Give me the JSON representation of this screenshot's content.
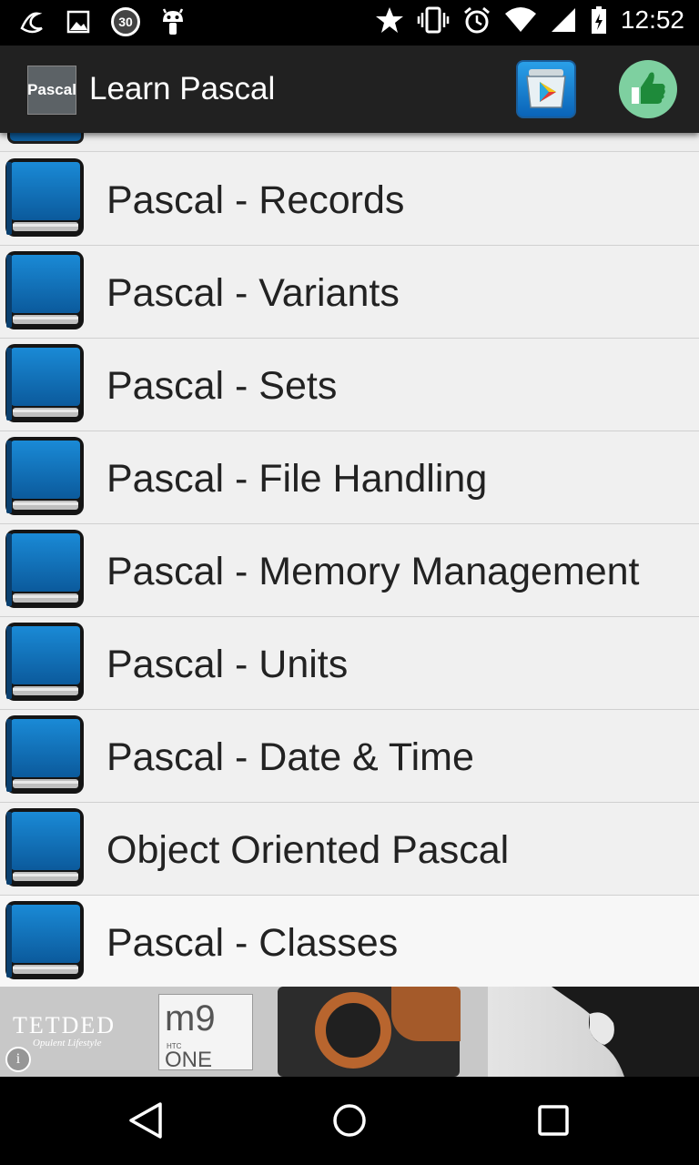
{
  "status_bar": {
    "time": "12:52",
    "notification_badge": "30",
    "left_icons": [
      "weather-icon",
      "image-icon",
      "counter-badge-icon",
      "android-icon"
    ],
    "right_icons": [
      "star-icon",
      "vibrate-icon",
      "alarm-icon",
      "wifi-icon",
      "signal-icon",
      "battery-icon"
    ]
  },
  "toolbar": {
    "logo_text": "Pascal",
    "title": "Learn Pascal",
    "actions": [
      "play-store-icon",
      "thumbs-up-icon"
    ]
  },
  "list": {
    "items": [
      {
        "label": "Pascal - Records"
      },
      {
        "label": "Pascal - Variants"
      },
      {
        "label": "Pascal - Sets"
      },
      {
        "label": "Pascal - File Handling"
      },
      {
        "label": "Pascal - Memory Management"
      },
      {
        "label": "Pascal - Units"
      },
      {
        "label": "Pascal - Date & Time"
      },
      {
        "label": "Object Oriented Pascal"
      },
      {
        "label": "Pascal - Classes"
      }
    ]
  },
  "ad": {
    "brand": "TETDED",
    "tagline": "Opulent Lifestyle",
    "product_model": "m9",
    "product_maker": "HTC",
    "product_line": "ONE",
    "info_symbol": "i"
  },
  "colors": {
    "toolbar_bg": "#212121",
    "list_bg": "#f0f0f0",
    "book_blue": "#0e6fb8",
    "like_green": "#7ed0a0"
  }
}
